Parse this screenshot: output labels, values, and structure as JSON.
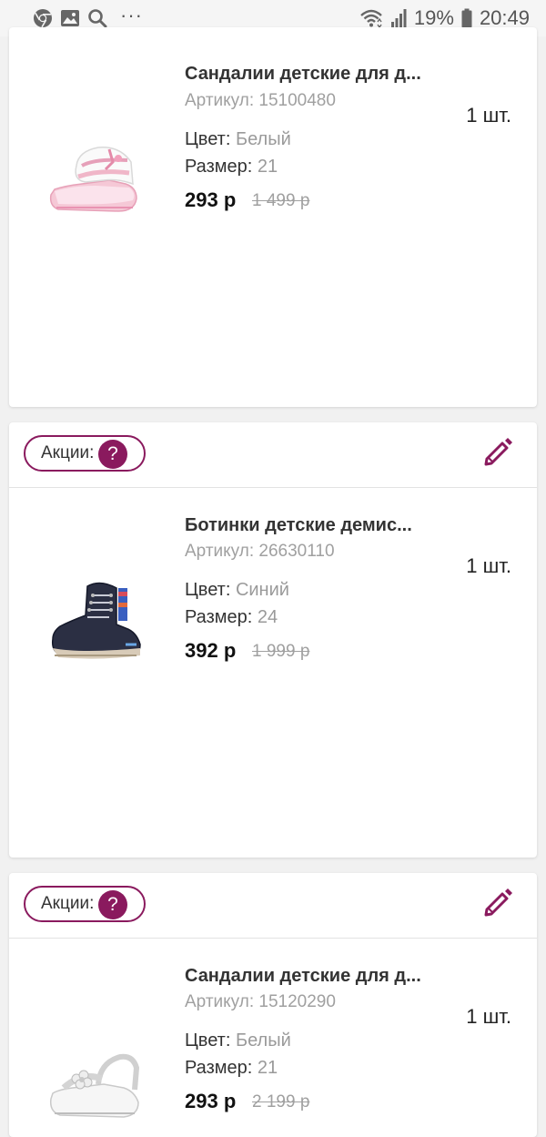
{
  "status_bar": {
    "battery": "19%",
    "time": "20:49",
    "more": "···",
    "icons": [
      "chrome-icon",
      "gallery-icon",
      "search-icon",
      "wifi-icon",
      "signal-icon",
      "battery-icon"
    ]
  },
  "colors": {
    "accent": "#8a1a5e"
  },
  "items": [
    {
      "name": "Сандалии детские для д...",
      "sku_label": "Артикул:",
      "sku": "15100480",
      "qty": "1 шт.",
      "color_label": "Цвет:",
      "color": "Белый",
      "size_label": "Размер:",
      "size": "21",
      "price": "293 р",
      "old_price": "1 499 р"
    },
    {
      "promo_label": "Акции:",
      "promo_q": "?",
      "name": "Ботинки детские демис...",
      "sku_label": "Артикул:",
      "sku": "26630110",
      "qty": "1 шт.",
      "color_label": "Цвет:",
      "color": "Синий",
      "size_label": "Размер:",
      "size": "24",
      "price": "392 р",
      "old_price": "1 999 р"
    },
    {
      "promo_label": "Акции:",
      "promo_q": "?",
      "name": "Сандалии детские для д...",
      "sku_label": "Артикул:",
      "sku": "15120290",
      "qty": "1 шт.",
      "color_label": "Цвет:",
      "color": "Белый",
      "size_label": "Размер:",
      "size": "21",
      "price": "293 р",
      "old_price": "2 199 р"
    }
  ]
}
